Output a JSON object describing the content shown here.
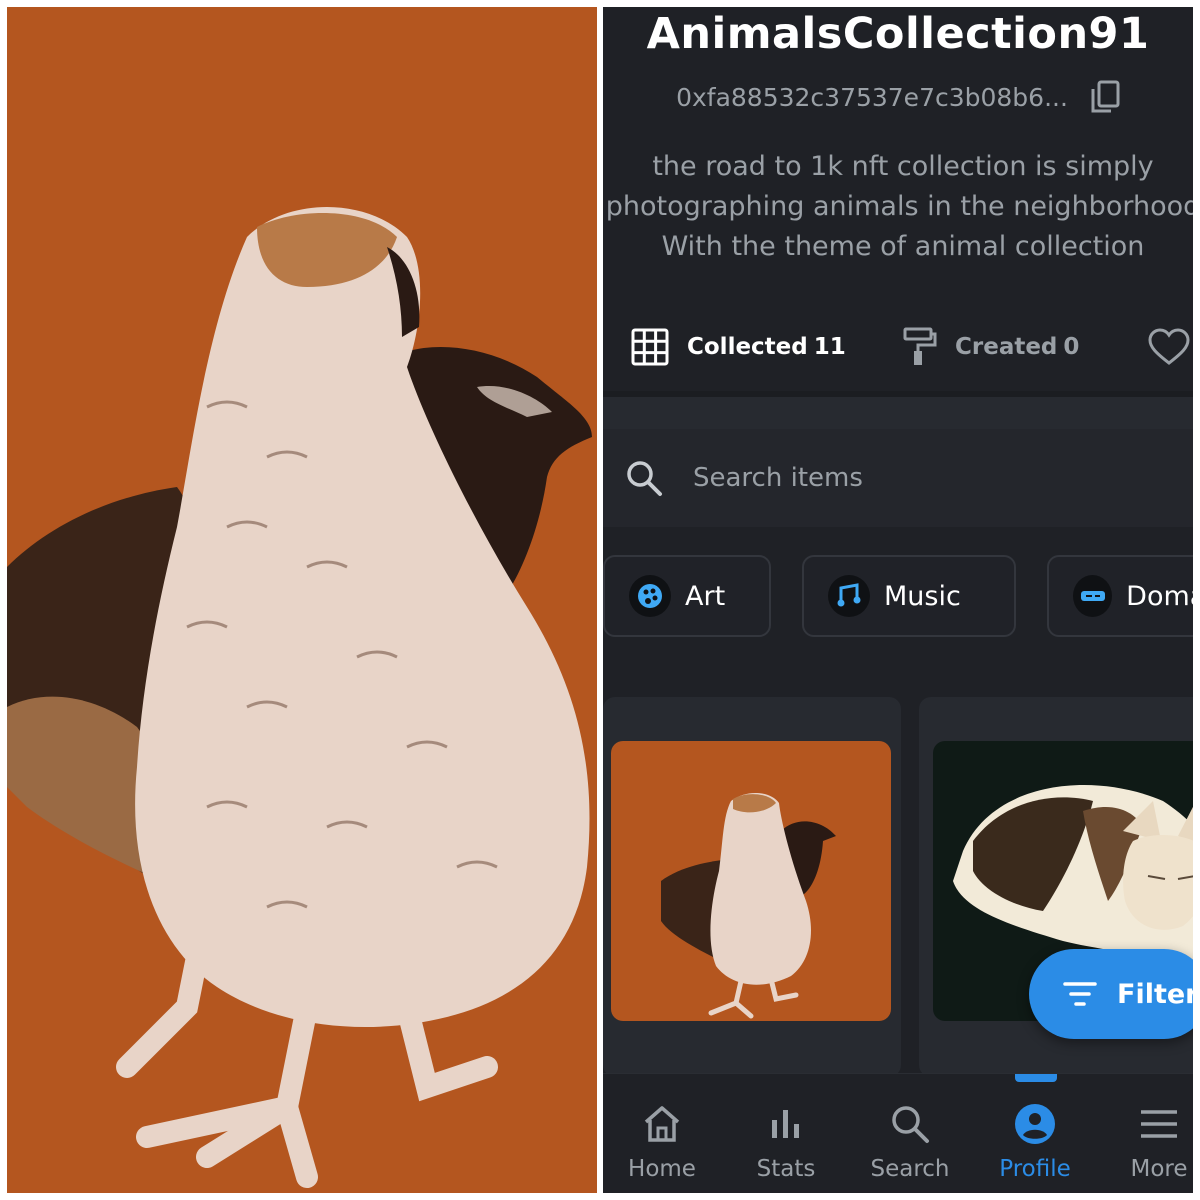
{
  "profile": {
    "collection_name": "AnimalsCollection91",
    "wallet_address": "0xfa88532c37537e7c3b08b6...",
    "bio_lines": [
      "the road to 1k nft collection is simply",
      "photographing animals in the neighborhood",
      "With the theme of animal collection"
    ]
  },
  "tabs": [
    {
      "label": "Collected",
      "count": "11",
      "icon": "grid-icon",
      "active": true
    },
    {
      "label": "Created",
      "count": "0",
      "icon": "paint-roller-icon",
      "active": false
    },
    {
      "label": "",
      "count": "",
      "icon": "heart-icon",
      "active": false
    }
  ],
  "search": {
    "placeholder": "Search items"
  },
  "categories": [
    {
      "label": "Art",
      "icon": "palette-icon"
    },
    {
      "label": "Music",
      "icon": "music-note-icon"
    },
    {
      "label": "Domains",
      "icon": "domain-icon"
    }
  ],
  "filter": {
    "label": "Filter"
  },
  "bottom_nav": [
    {
      "label": "Home",
      "icon": "home-icon"
    },
    {
      "label": "Stats",
      "icon": "bar-chart-icon"
    },
    {
      "label": "Search",
      "icon": "search-icon"
    },
    {
      "label": "Profile",
      "icon": "profile-icon",
      "active": true
    },
    {
      "label": "More",
      "icon": "menu-icon"
    }
  ],
  "colors": {
    "background": "#1f2126",
    "accent": "#2b8ce6",
    "muted_text": "#9aa0a6",
    "artwork_background": "#b4561f"
  }
}
